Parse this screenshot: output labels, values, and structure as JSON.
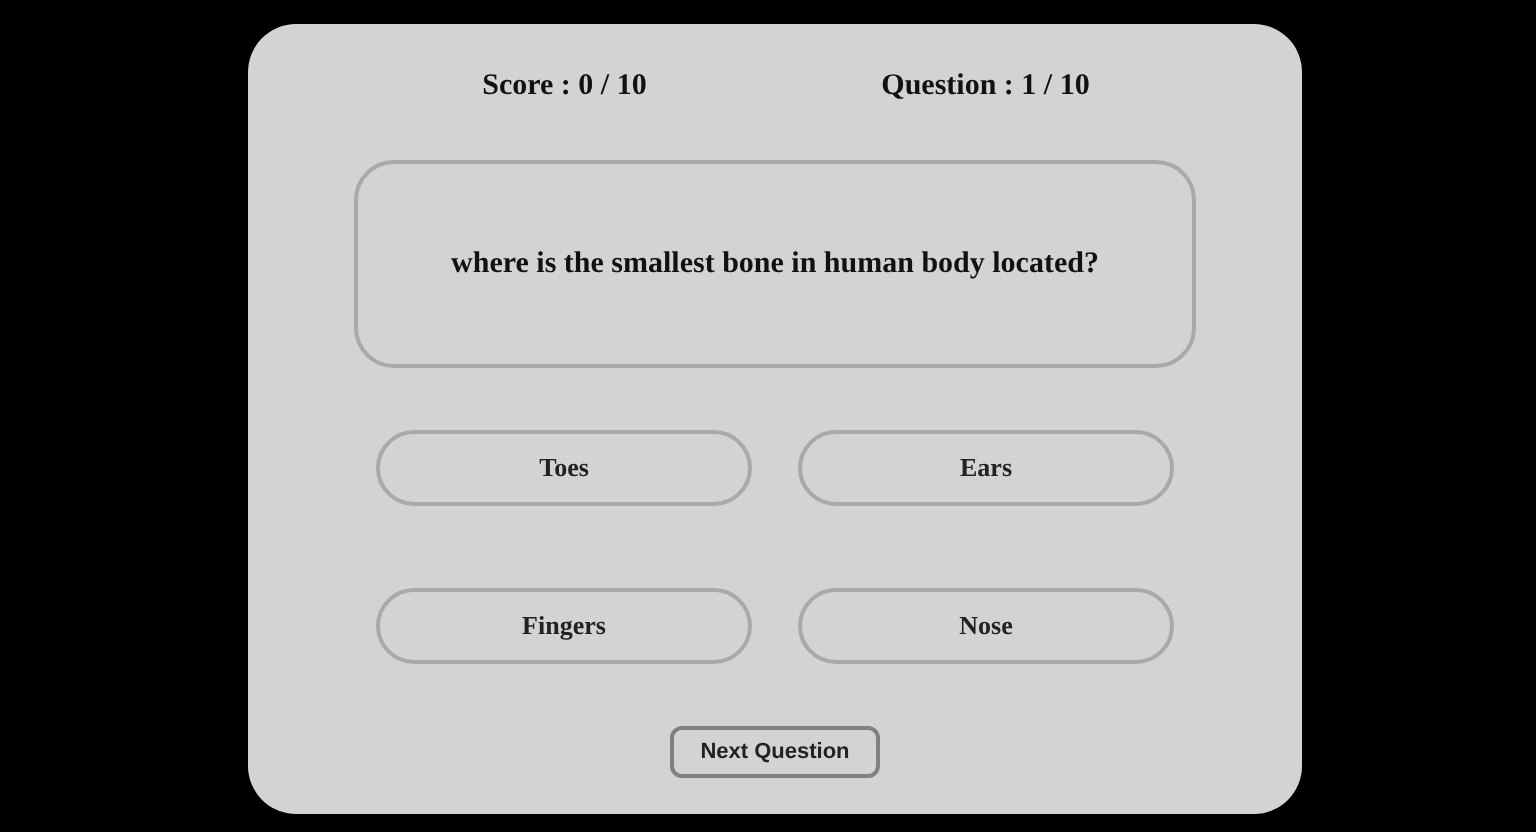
{
  "score": "Score : 0 / 10",
  "progress": "Question : 1 / 10",
  "question": "where is the smallest bone in human body located?",
  "options": [
    {
      "label": "Toes"
    },
    {
      "label": "Ears"
    },
    {
      "label": "Fingers"
    },
    {
      "label": "Nose"
    }
  ],
  "next_button": "Next Question"
}
